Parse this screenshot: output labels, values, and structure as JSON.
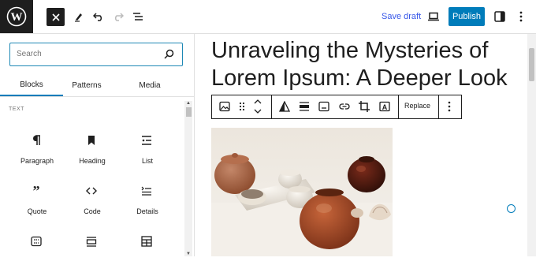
{
  "topbar": {
    "logo_icon": "wordpress-logo",
    "close_icon": "close-icon",
    "tools": [
      "pen-icon",
      "undo-icon",
      "redo-icon",
      "list-view-icon"
    ],
    "save_draft": "Save draft",
    "publish": "Publish",
    "view_icon": "laptop-icon",
    "settings_icon": "sidebar-icon",
    "more_icon": "more-vertical-icon"
  },
  "inserter": {
    "search_placeholder": "Search",
    "tabs": [
      "Blocks",
      "Patterns",
      "Media"
    ],
    "active_tab": "Blocks",
    "category": "TEXT",
    "blocks": [
      {
        "label": "Paragraph",
        "icon": "paragraph-icon"
      },
      {
        "label": "Heading",
        "icon": "bookmark-icon"
      },
      {
        "label": "List",
        "icon": "list-icon"
      },
      {
        "label": "Quote",
        "icon": "quote-icon"
      },
      {
        "label": "Code",
        "icon": "code-icon"
      },
      {
        "label": "Details",
        "icon": "details-icon"
      },
      {
        "label": "",
        "icon": "classic-icon"
      },
      {
        "label": "",
        "icon": "preformatted-icon"
      },
      {
        "label": "",
        "icon": "table-icon"
      }
    ]
  },
  "editor": {
    "post_title": "Unraveling the Mysteries of Lorem Ipsum: A Deeper Look",
    "toolbar": {
      "replace": "Replace"
    }
  },
  "colors": {
    "accent": "#007cba",
    "link": "#3858e9",
    "dark": "#1e1e1e"
  }
}
